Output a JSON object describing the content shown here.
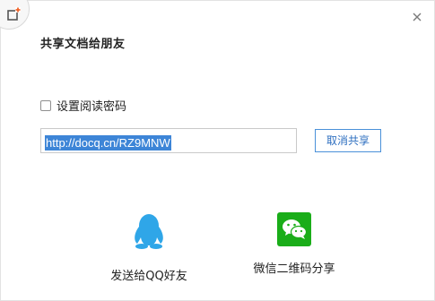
{
  "dialog": {
    "title": "共享文档给朋友",
    "password": {
      "label": "设置阅读密码",
      "checked": false
    },
    "link": {
      "value": "http://docq.cn/RZ9MNW"
    },
    "cancel_share_label": "取消共享",
    "share": {
      "qq_label": "发送给QQ好友",
      "wechat_label": "微信二维码分享"
    },
    "colors": {
      "accent": "#3d85d7",
      "qq_blue": "#2fa6e8",
      "wechat_green": "#1aad19",
      "badge_orange": "#f0642a"
    },
    "icons": [
      "app-share-icon",
      "close-icon",
      "qq-penguin-icon",
      "wechat-icon"
    ]
  }
}
